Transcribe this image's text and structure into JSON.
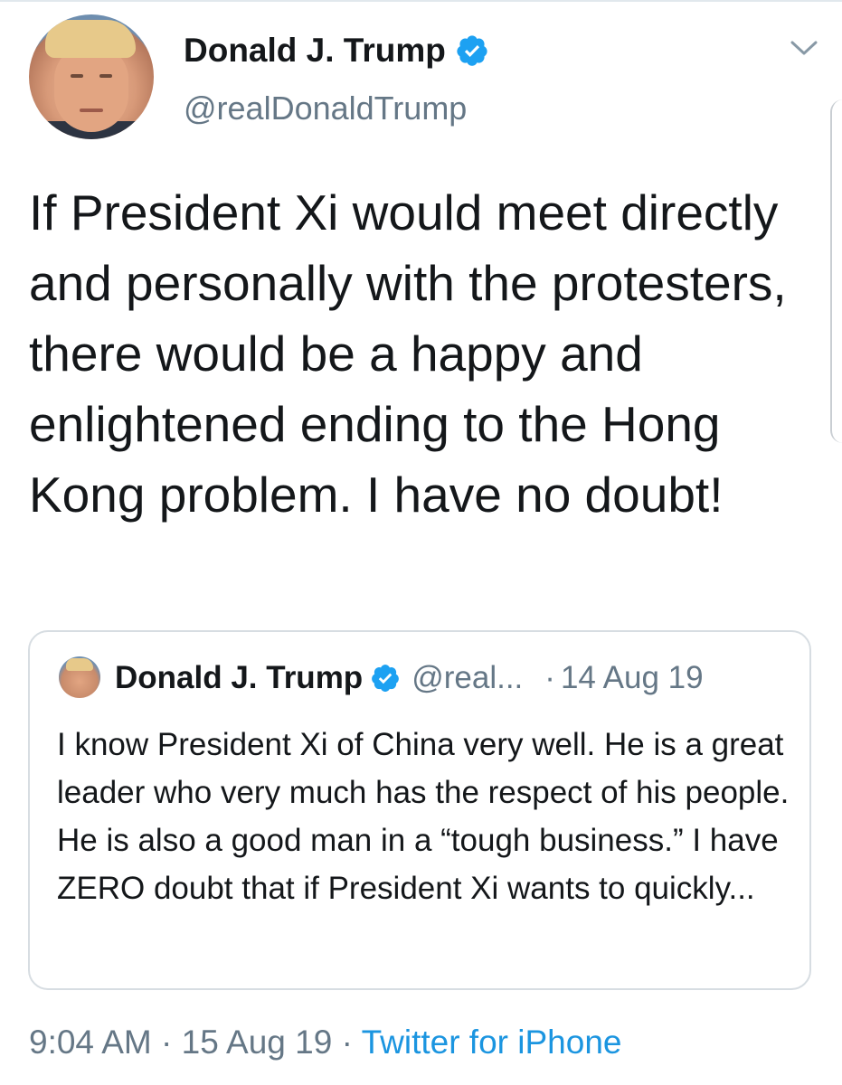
{
  "author": {
    "name": "Donald J. Trump",
    "handle": "@realDonaldTrump",
    "verified_icon": "verified-badge-icon"
  },
  "tweet": {
    "text": "If President Xi would meet directly and personally with the protesters, there would be a happy and enlightened ending to the Hong Kong problem. I have no doubt!"
  },
  "quoted_tweet": {
    "name": "Donald J. Trump",
    "handle": "@real...",
    "separator": "·",
    "date": "14 Aug 19",
    "text": "I know President Xi of China very well. He is a great leader who very much has the respect of his people. He is also a good man in a “tough business.” I have ZERO doubt that if President Xi wants to quickly..."
  },
  "footer": {
    "time": "9:04 AM",
    "sep1": "·",
    "date": "15 Aug 19",
    "sep2": "·",
    "source": "Twitter for iPhone"
  },
  "colors": {
    "text": "#14171a",
    "muted": "#657786",
    "link": "#1b95e0",
    "verified": "#1da1f2",
    "border": "#d7dde2"
  }
}
